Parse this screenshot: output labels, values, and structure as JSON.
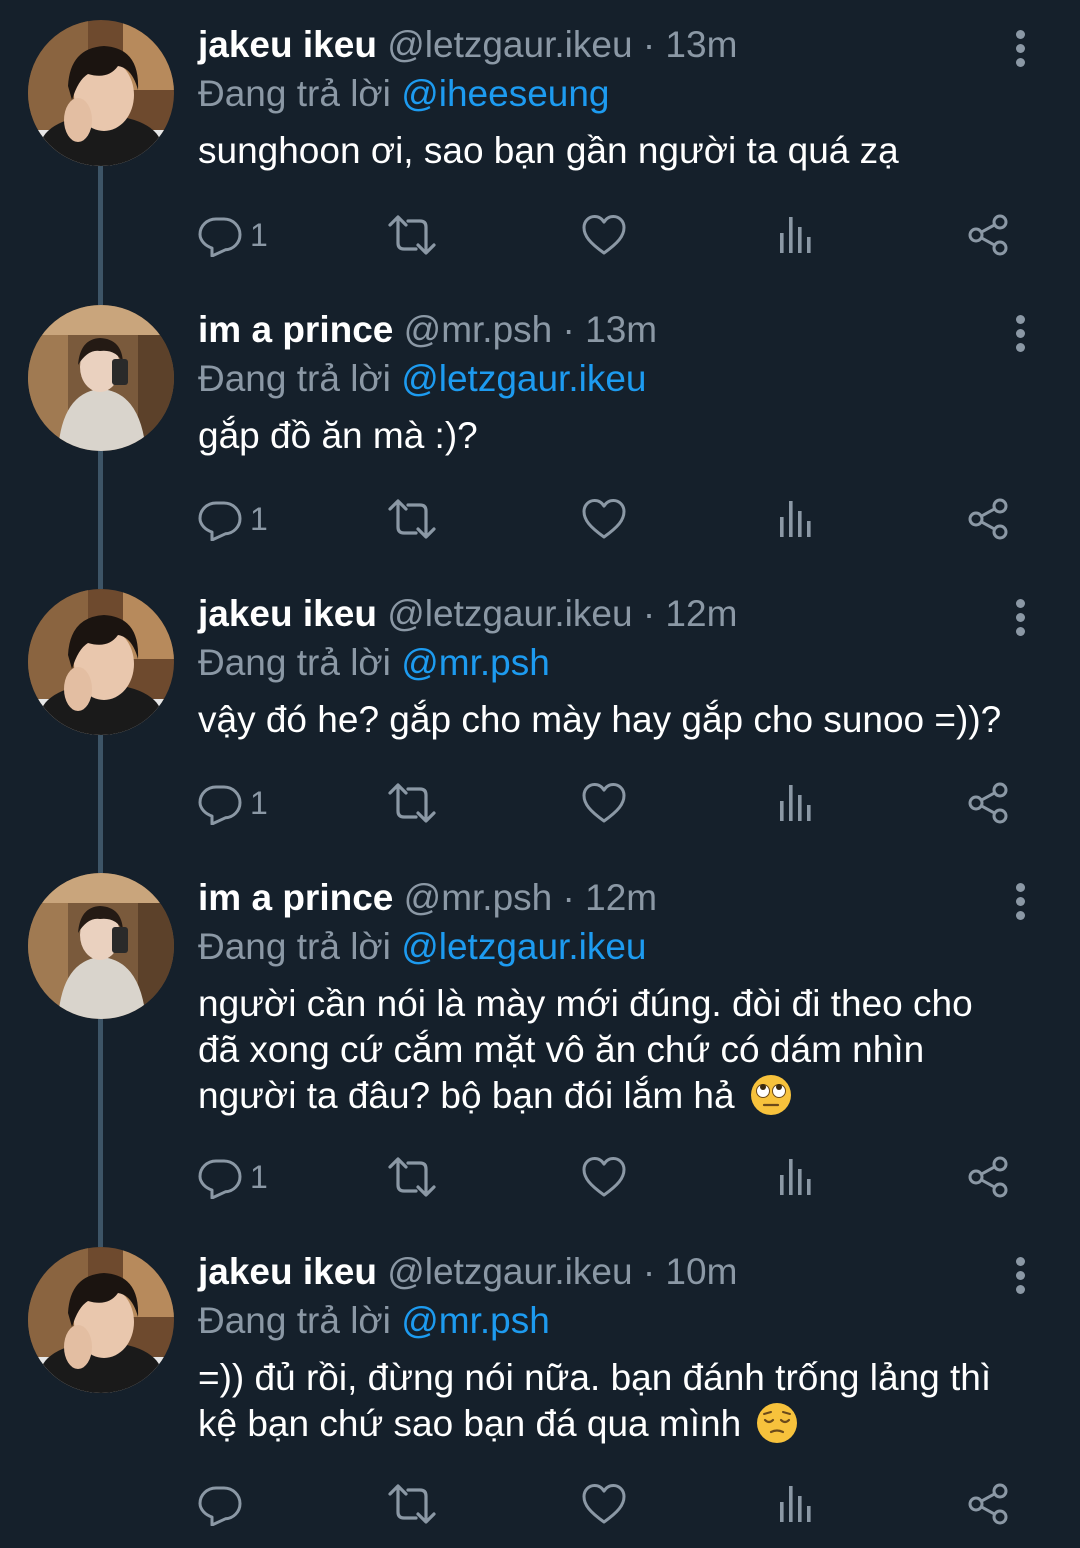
{
  "colors": {
    "background": "#15202b",
    "secondary_text": "#8b98a5",
    "mention": "#1d9bf0",
    "thread_line": "#3d5466"
  },
  "tweets": [
    {
      "author": "jakeu ikeu",
      "handle": "@letzgaur.ikeu",
      "separator": "·",
      "time": "13m",
      "reply_prefix": "Đang trả lời",
      "reply_to": "@iheeseung",
      "lines": [
        "sunghoon ơi, sao bạn gần người ta quá zạ"
      ],
      "reply_count": "1",
      "avatar": "avatar-jake"
    },
    {
      "author": "im a prince",
      "handle": "@mr.psh",
      "separator": "·",
      "time": "13m",
      "reply_prefix": "Đang trả lời",
      "reply_to": "@letzgaur.ikeu",
      "lines": [
        "gắp đồ ăn mà :)?"
      ],
      "reply_count": "1",
      "avatar": "avatar-prince"
    },
    {
      "author": "jakeu ikeu",
      "handle": "@letzgaur.ikeu",
      "separator": "·",
      "time": "12m",
      "reply_prefix": "Đang trả lời",
      "reply_to": "@mr.psh",
      "lines": [
        "vậy đó he? gắp cho mày hay gắp cho sunoo =))?"
      ],
      "reply_count": "1",
      "avatar": "avatar-jake"
    },
    {
      "author": "im a prince",
      "handle": "@mr.psh",
      "separator": "·",
      "time": "12m",
      "reply_prefix": "Đang trả lời",
      "reply_to": "@letzgaur.ikeu",
      "lines": [
        "người cần nói là mày mới đúng. đòi đi theo cho",
        "đã xong cứ cắm mặt vô ăn chứ có dám nhìn",
        "người ta đâu? bộ bạn đói lắm hả"
      ],
      "trailing_emoji": "face-with-rolling-eyes-emoji",
      "reply_count": "1",
      "avatar": "avatar-prince"
    },
    {
      "author": "jakeu ikeu",
      "handle": "@letzgaur.ikeu",
      "separator": "·",
      "time": "10m",
      "reply_prefix": "Đang trả lời",
      "reply_to": "@mr.psh",
      "lines": [
        "=)) đủ rồi, đừng nói nữa. bạn đánh trống lảng thì",
        "kệ bạn chứ sao bạn đá qua mình"
      ],
      "trailing_emoji": "pensive-face-emoji",
      "reply_count": "",
      "avatar": "avatar-jake"
    }
  ]
}
